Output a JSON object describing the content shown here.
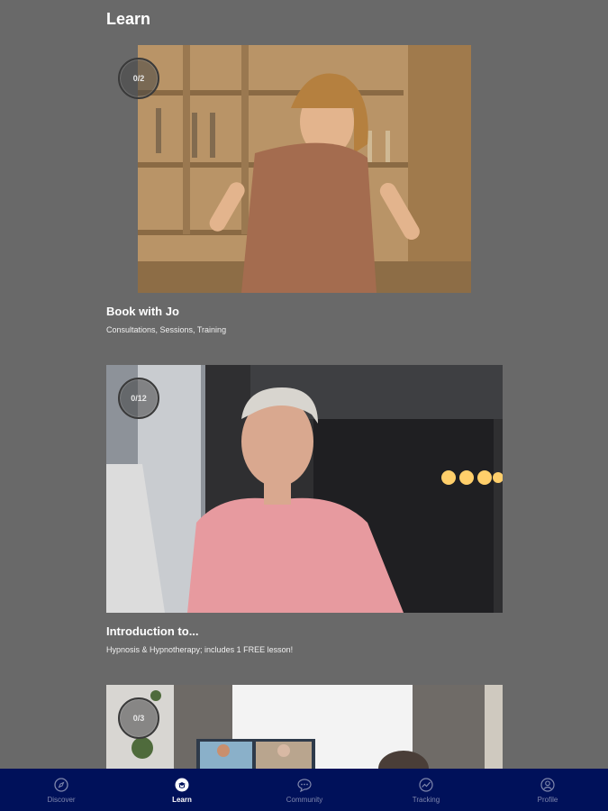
{
  "header": {
    "title": "Learn"
  },
  "cards": [
    {
      "progress": "0/2",
      "title": "Book with Jo",
      "subtitle": "Consultations, Sessions, Training"
    },
    {
      "progress": "0/12",
      "title": "Introduction to...",
      "subtitle": "Hypnosis & Hypnotherapy; includes 1 FREE lesson!"
    },
    {
      "progress": "0/3",
      "title": "",
      "subtitle": ""
    }
  ],
  "nav": {
    "items": [
      {
        "label": "Discover",
        "icon": "compass-icon"
      },
      {
        "label": "Learn",
        "icon": "learn-icon"
      },
      {
        "label": "Community",
        "icon": "chat-icon"
      },
      {
        "label": "Tracking",
        "icon": "chart-icon"
      },
      {
        "label": "Profile",
        "icon": "profile-icon"
      }
    ],
    "active": "Learn"
  },
  "colors": {
    "background": "#696969",
    "nav_background": "#00115a",
    "nav_active": "#ffffff",
    "nav_inactive": "#7f87ad"
  }
}
